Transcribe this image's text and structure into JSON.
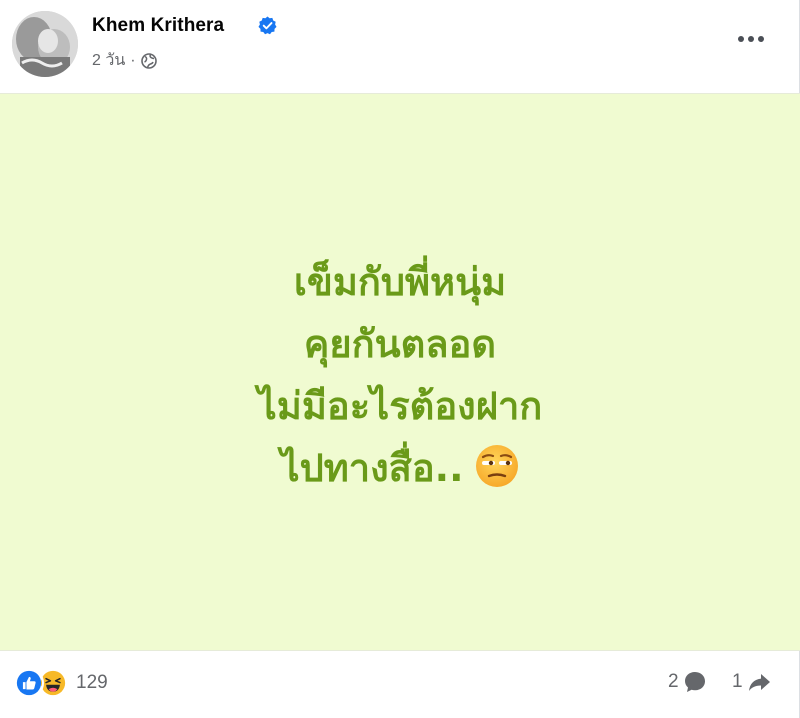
{
  "post": {
    "author": "Khem Krithera",
    "verified": true,
    "timestamp": "2 วัน",
    "separator": "·",
    "audience_icon": "globe-icon",
    "more_icon": "more-options-icon",
    "body_lines": [
      "เข็มกับพี่หนุ่ม",
      "คุยกันตลอด",
      "ไม่มีอะไรต้องฝาก",
      "ไปทางสื่อ.."
    ],
    "body_emoji": "unamused-face-emoji",
    "background_color": "#f0fbd1",
    "text_color": "#6a9a19"
  },
  "footer": {
    "reaction_icons": [
      "like-reaction-icon",
      "haha-reaction-icon"
    ],
    "reaction_count": "129",
    "comment_count": "2",
    "share_count": "1"
  }
}
